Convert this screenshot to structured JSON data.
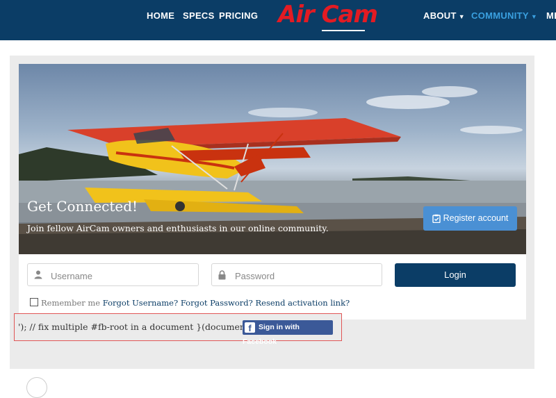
{
  "nav": {
    "items": [
      {
        "label": "HOME"
      },
      {
        "label": "SPECS"
      },
      {
        "label": "PRICING"
      },
      {
        "label": "ABOUT"
      },
      {
        "label": "COMMUNITY"
      },
      {
        "label": "ME"
      }
    ],
    "logo_text": "Air Cam",
    "active_color": "#3aa0e0",
    "header_color": "#0b3d66"
  },
  "hero": {
    "title": "Get Connected!",
    "subtitle": "Join fellow AirCam owners and enthusiasts in our online community.",
    "register_label": "Register account",
    "register_icon": "clipboard-check-icon"
  },
  "login": {
    "username_placeholder": "Username",
    "password_placeholder": "Password",
    "username_icon": "user-icon",
    "password_icon": "lock-icon",
    "login_label": "Login",
    "remember_label": "Remember me",
    "forgot_username": "Forgot Username?",
    "forgot_password": "Forgot Password?",
    "resend_activation": "Resend activation link?"
  },
  "facebook": {
    "code_text": "'); // fix multiple #fb-root in a document }(document));",
    "button_label": "Sign in with Facebook",
    "icon": "facebook-icon",
    "color": "#3b5998"
  }
}
